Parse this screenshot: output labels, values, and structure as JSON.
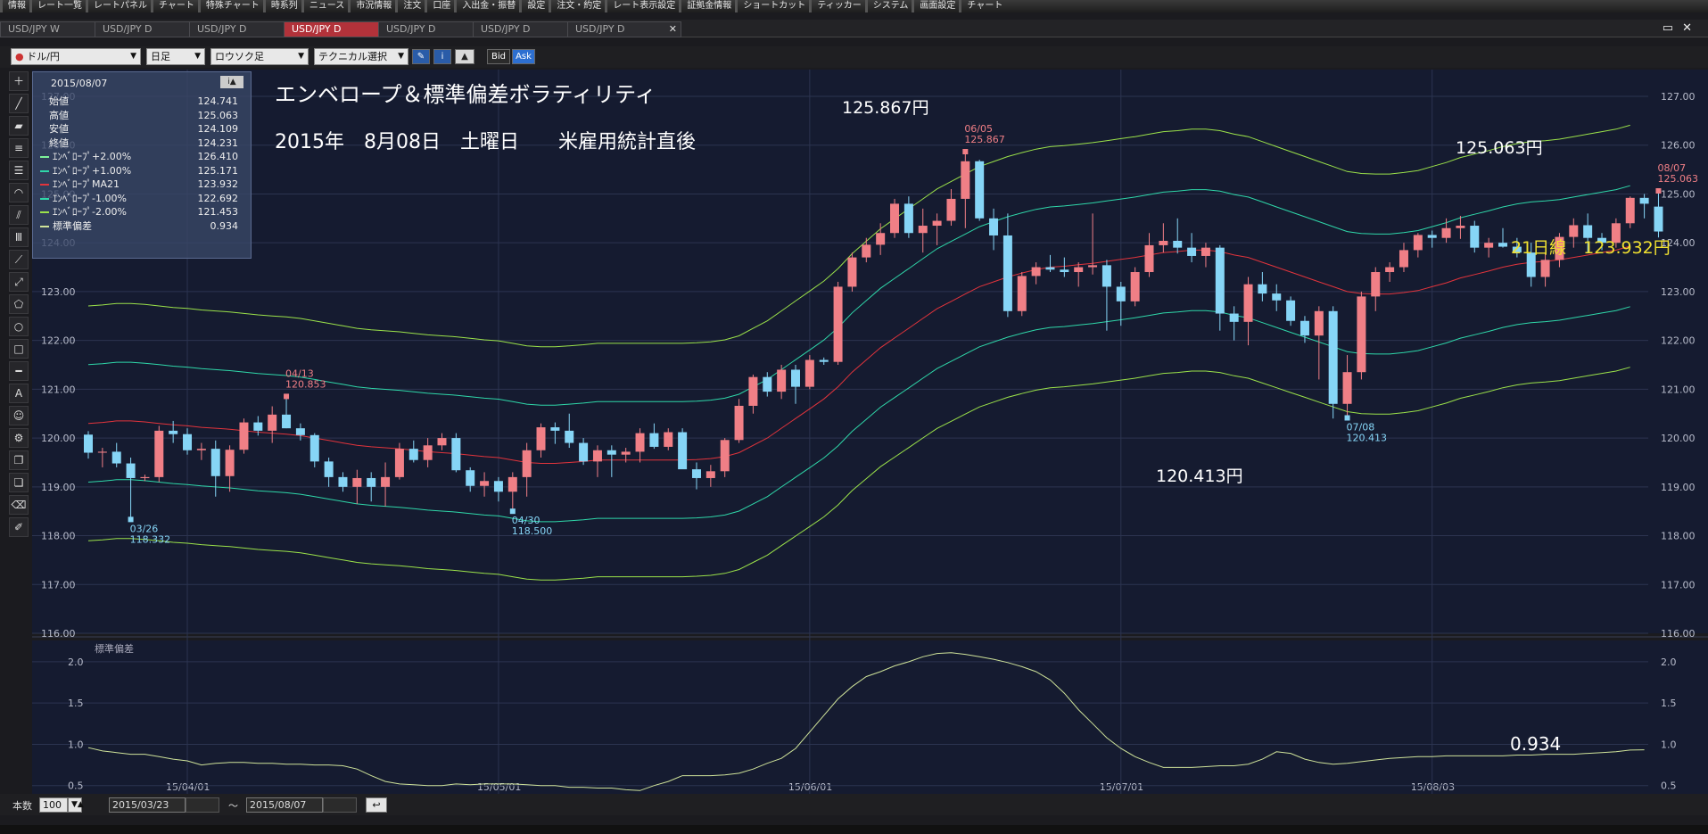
{
  "menu": [
    "情報",
    "レート一覧",
    "レートパネル",
    "チャート",
    "特殊チャート",
    "時系列",
    "ニュース",
    "市況情報",
    "注文",
    "口座",
    "入出金・振替",
    "設定",
    "注文・約定",
    "レート表示設定",
    "証拠金情報",
    "ショートカット",
    "ティッカー",
    "システム",
    "画面設定",
    "チャート"
  ],
  "tabs": [
    {
      "label": "USD/JPY W",
      "active": false
    },
    {
      "label": "USD/JPY D",
      "active": false
    },
    {
      "label": "USD/JPY D",
      "active": false
    },
    {
      "label": "USD/JPY D",
      "active": true
    },
    {
      "label": "USD/JPY D",
      "active": false
    },
    {
      "label": "USD/JPY D",
      "active": false
    },
    {
      "label": "USD/JPY D",
      "active": false
    }
  ],
  "toolbar": {
    "pair": "ドル/円",
    "period": "日足",
    "style": "ロウソク足",
    "tech": "テクニカル選択",
    "bid": "Bid",
    "ask": "Ask"
  },
  "info": {
    "date": "2015/08/07",
    "rows": [
      {
        "label": "始値",
        "value": "124.741",
        "color": ""
      },
      {
        "label": "高値",
        "value": "125.063",
        "color": ""
      },
      {
        "label": "安値",
        "value": "124.109",
        "color": ""
      },
      {
        "label": "終値",
        "value": "124.231",
        "color": ""
      },
      {
        "label": "ｴﾝﾍﾞﾛｰﾌﾟ+2.00%",
        "value": "126.410",
        "color": "#7ef29a"
      },
      {
        "label": "ｴﾝﾍﾞﾛｰﾌﾟ+1.00%",
        "value": "125.171",
        "color": "#2fd7a9"
      },
      {
        "label": "ｴﾝﾍﾞﾛｰﾌﾟMA21",
        "value": "123.932",
        "color": "#e2343c"
      },
      {
        "label": "ｴﾝﾍﾞﾛｰﾌﾟ-1.00%",
        "value": "122.692",
        "color": "#2fd7a9"
      },
      {
        "label": "ｴﾝﾍﾞﾛｰﾌﾟ-2.00%",
        "value": "121.453",
        "color": "#9be24a"
      },
      {
        "label": "標準偏差",
        "value": "0.934",
        "color": "#cfe39a"
      }
    ]
  },
  "annotations": {
    "title": "エンベロープ＆標準偏差ボラティリティ",
    "subtitle": "2015年　8月08日　土曜日　　米雇用統計直後",
    "high1": "125.867円",
    "high2": "125.063円",
    "low1": "120.413円",
    "ma21": "21日線　123.932円",
    "sd": "0.934"
  },
  "chart_labels": {
    "hi0605_date": "06/05",
    "hi0605_val": "125.867",
    "hi0807_date": "08/07",
    "hi0807_val": "125.063",
    "hi0413_date": "04/13",
    "hi0413_val": "120.853",
    "lo0326_date": "03/26",
    "lo0326_val": "118.332",
    "lo0430_date": "04/30",
    "lo0430_val": "118.500",
    "lo0708_date": "07/08",
    "lo0708_val": "120.413",
    "sub_title": "標準偏差"
  },
  "colors": {
    "bg": "#151b30",
    "up": "#f07f86",
    "down": "#86d5f6",
    "ma": "#e2343c",
    "env1": "#2fd7a9",
    "env2": "#9be24a",
    "sd": "#cfe39a",
    "price_label": "#ffffff",
    "yellow": "#f0e030"
  },
  "bottom": {
    "count_label": "本数",
    "count": "100",
    "from": "2015/03/23",
    "tilde": "～",
    "to": "2015/08/07"
  },
  "chart_data": {
    "type": "candlestick",
    "ylim": [
      116.0,
      127.0
    ],
    "yticks": [
      "127.00",
      "126.00",
      "125.00",
      "124.00",
      "123.00",
      "122.00",
      "121.00",
      "120.00",
      "119.00",
      "118.00",
      "117.00",
      "116.00"
    ],
    "xticks": [
      "15/04/01",
      "15/05/01",
      "15/06/01",
      "15/07/01",
      "15/08/03"
    ],
    "sub_ylim": [
      0.4,
      2.15
    ],
    "sub_yticks": [
      "2.0",
      "1.5",
      "1.0",
      "0.5"
    ],
    "candles": [
      [
        120.07,
        120.14,
        119.58,
        119.7
      ],
      [
        119.7,
        119.8,
        119.4,
        119.72
      ],
      [
        119.72,
        119.9,
        119.4,
        119.48
      ],
      [
        119.48,
        119.6,
        118.332,
        119.18
      ],
      [
        119.18,
        119.25,
        119.12,
        119.2
      ],
      [
        119.2,
        120.25,
        119.1,
        120.15
      ],
      [
        120.15,
        120.35,
        119.9,
        120.08
      ],
      [
        120.08,
        120.2,
        119.66,
        119.75
      ],
      [
        119.75,
        119.9,
        119.55,
        119.78
      ],
      [
        119.78,
        119.95,
        118.8,
        119.22
      ],
      [
        119.22,
        119.85,
        118.9,
        119.76
      ],
      [
        119.76,
        120.4,
        119.68,
        120.32
      ],
      [
        120.32,
        120.45,
        120.05,
        120.15
      ],
      [
        120.15,
        120.65,
        119.9,
        120.48
      ],
      [
        120.48,
        120.853,
        120.2,
        120.2
      ],
      [
        120.2,
        120.3,
        119.95,
        120.06
      ],
      [
        120.06,
        120.1,
        119.4,
        119.52
      ],
      [
        119.52,
        119.6,
        119.0,
        119.2
      ],
      [
        119.2,
        119.3,
        118.9,
        119.0
      ],
      [
        119.0,
        119.35,
        118.65,
        119.18
      ],
      [
        119.18,
        119.3,
        118.7,
        119.0
      ],
      [
        119.0,
        119.5,
        118.6,
        119.2
      ],
      [
        119.2,
        119.9,
        119.15,
        119.78
      ],
      [
        119.78,
        119.95,
        119.5,
        119.55
      ],
      [
        119.55,
        120.0,
        119.4,
        119.85
      ],
      [
        119.85,
        120.1,
        119.75,
        120.0
      ],
      [
        120.0,
        120.1,
        119.3,
        119.34
      ],
      [
        119.34,
        119.4,
        118.9,
        119.02
      ],
      [
        119.02,
        119.3,
        118.8,
        119.12
      ],
      [
        119.12,
        119.2,
        118.7,
        118.9
      ],
      [
        118.9,
        119.3,
        118.5,
        119.2
      ],
      [
        119.2,
        119.9,
        118.8,
        119.75
      ],
      [
        119.75,
        120.3,
        119.6,
        120.22
      ],
      [
        120.22,
        120.32,
        119.88,
        120.15
      ],
      [
        120.15,
        120.5,
        119.8,
        119.9
      ],
      [
        119.9,
        120.0,
        119.45,
        119.52
      ],
      [
        119.52,
        119.85,
        119.2,
        119.75
      ],
      [
        119.75,
        119.85,
        119.2,
        119.66
      ],
      [
        119.66,
        119.8,
        119.5,
        119.72
      ],
      [
        119.72,
        120.2,
        119.5,
        120.1
      ],
      [
        120.1,
        120.3,
        119.78,
        119.82
      ],
      [
        119.82,
        120.2,
        119.75,
        120.12
      ],
      [
        120.12,
        120.2,
        119.38,
        119.36
      ],
      [
        119.36,
        119.5,
        118.95,
        119.18
      ],
      [
        119.18,
        119.45,
        119.0,
        119.32
      ],
      [
        119.32,
        120.0,
        119.2,
        119.96
      ],
      [
        119.96,
        120.8,
        119.9,
        120.66
      ],
      [
        120.66,
        121.3,
        120.5,
        121.25
      ],
      [
        121.25,
        121.35,
        120.85,
        120.95
      ],
      [
        120.95,
        121.5,
        120.8,
        121.4
      ],
      [
        121.4,
        121.5,
        120.7,
        121.05
      ],
      [
        121.05,
        121.7,
        121.0,
        121.6
      ],
      [
        121.6,
        121.65,
        121.5,
        121.56
      ],
      [
        121.56,
        123.2,
        121.5,
        123.1
      ],
      [
        123.1,
        123.8,
        123.0,
        123.7
      ],
      [
        123.7,
        124.1,
        123.6,
        123.96
      ],
      [
        123.96,
        124.4,
        123.75,
        124.2
      ],
      [
        124.2,
        124.9,
        124.1,
        124.8
      ],
      [
        124.8,
        124.95,
        124.1,
        124.2
      ],
      [
        124.2,
        124.7,
        123.8,
        124.35
      ],
      [
        124.35,
        124.6,
        123.95,
        124.45
      ],
      [
        124.45,
        125.1,
        124.35,
        124.9
      ],
      [
        124.9,
        125.867,
        124.3,
        125.67
      ],
      [
        125.67,
        125.7,
        124.45,
        124.5
      ],
      [
        124.5,
        124.7,
        123.85,
        124.15
      ],
      [
        124.15,
        124.6,
        122.48,
        122.6
      ],
      [
        122.6,
        123.4,
        122.5,
        123.32
      ],
      [
        123.32,
        123.6,
        123.15,
        123.5
      ],
      [
        123.5,
        123.75,
        123.4,
        123.45
      ],
      [
        123.45,
        123.7,
        123.3,
        123.4
      ],
      [
        123.4,
        123.6,
        123.1,
        123.5
      ],
      [
        123.5,
        124.6,
        123.35,
        123.54
      ],
      [
        123.54,
        123.65,
        122.2,
        123.1
      ],
      [
        123.1,
        123.2,
        122.3,
        122.8
      ],
      [
        122.8,
        123.5,
        122.7,
        123.4
      ],
      [
        123.4,
        124.2,
        123.3,
        123.95
      ],
      [
        123.95,
        124.4,
        123.8,
        124.04
      ],
      [
        124.04,
        124.5,
        123.78,
        123.9
      ],
      [
        123.9,
        124.2,
        123.6,
        123.73
      ],
      [
        123.73,
        124.0,
        123.5,
        123.9
      ],
      [
        123.9,
        123.95,
        122.2,
        122.55
      ],
      [
        122.55,
        122.7,
        122.0,
        122.38
      ],
      [
        122.38,
        123.3,
        121.9,
        123.15
      ],
      [
        123.15,
        123.4,
        122.8,
        122.96
      ],
      [
        122.96,
        123.15,
        122.6,
        122.82
      ],
      [
        122.82,
        122.9,
        122.3,
        122.4
      ],
      [
        122.4,
        122.5,
        121.95,
        122.1
      ],
      [
        122.1,
        122.7,
        121.2,
        122.6
      ],
      [
        122.6,
        122.7,
        120.4,
        120.7
      ],
      [
        120.7,
        121.7,
        120.413,
        121.35
      ],
      [
        121.35,
        123.0,
        121.2,
        122.9
      ],
      [
        122.9,
        123.5,
        122.6,
        123.4
      ],
      [
        123.4,
        123.6,
        123.2,
        123.5
      ],
      [
        123.5,
        124.0,
        123.4,
        123.85
      ],
      [
        123.85,
        124.2,
        123.7,
        124.16
      ],
      [
        124.16,
        124.25,
        123.9,
        124.1
      ],
      [
        124.1,
        124.5,
        124.0,
        124.3
      ],
      [
        124.3,
        124.55,
        124.08,
        124.35
      ],
      [
        124.35,
        124.45,
        123.8,
        123.9
      ],
      [
        123.9,
        124.1,
        123.7,
        124.0
      ],
      [
        124.0,
        124.3,
        123.9,
        123.92
      ],
      [
        123.92,
        124.1,
        123.7,
        123.8
      ],
      [
        123.8,
        124.0,
        123.1,
        123.3
      ],
      [
        123.3,
        123.8,
        123.1,
        123.65
      ],
      [
        123.65,
        124.2,
        123.5,
        124.12
      ],
      [
        124.12,
        124.5,
        123.9,
        124.36
      ],
      [
        124.36,
        124.6,
        123.8,
        124.1
      ],
      [
        124.1,
        124.2,
        123.85,
        124.0
      ],
      [
        124.0,
        124.5,
        123.9,
        124.4
      ],
      [
        124.4,
        124.95,
        124.3,
        124.92
      ],
      [
        124.92,
        125.0,
        124.5,
        124.8
      ],
      [
        124.741,
        125.063,
        124.109,
        124.231
      ]
    ],
    "ma21": [
      120.3,
      120.32,
      120.35,
      120.35,
      120.33,
      120.3,
      120.27,
      120.25,
      120.22,
      120.2,
      120.18,
      120.15,
      120.12,
      120.1,
      120.08,
      120.05,
      120.0,
      119.95,
      119.9,
      119.85,
      119.82,
      119.8,
      119.78,
      119.75,
      119.72,
      119.7,
      119.68,
      119.65,
      119.62,
      119.6,
      119.55,
      119.5,
      119.48,
      119.48,
      119.5,
      119.52,
      119.55,
      119.55,
      119.55,
      119.55,
      119.55,
      119.55,
      119.55,
      119.56,
      119.58,
      119.62,
      119.7,
      119.85,
      120.0,
      120.2,
      120.4,
      120.6,
      120.8,
      121.05,
      121.35,
      121.6,
      121.85,
      122.05,
      122.25,
      122.45,
      122.65,
      122.8,
      122.95,
      123.1,
      123.2,
      123.3,
      123.38,
      123.45,
      123.5,
      123.52,
      123.55,
      123.58,
      123.62,
      123.66,
      123.7,
      123.75,
      123.8,
      123.82,
      123.85,
      123.85,
      123.82,
      123.75,
      123.7,
      123.6,
      123.5,
      123.4,
      123.3,
      123.2,
      123.1,
      123.0,
      122.96,
      122.95,
      122.95,
      122.98,
      123.02,
      123.1,
      123.18,
      123.28,
      123.35,
      123.42,
      123.5,
      123.56,
      123.6,
      123.62,
      123.65,
      123.7,
      123.75,
      123.8,
      123.85,
      123.93
    ],
    "stddev": [
      0.96,
      0.92,
      0.9,
      0.88,
      0.88,
      0.85,
      0.82,
      0.8,
      0.75,
      0.77,
      0.78,
      0.78,
      0.77,
      0.77,
      0.76,
      0.76,
      0.75,
      0.75,
      0.74,
      0.7,
      0.62,
      0.55,
      0.52,
      0.51,
      0.5,
      0.5,
      0.52,
      0.51,
      0.52,
      0.52,
      0.52,
      0.51,
      0.5,
      0.5,
      0.48,
      0.48,
      0.47,
      0.47,
      0.45,
      0.44,
      0.5,
      0.55,
      0.62,
      0.62,
      0.62,
      0.63,
      0.65,
      0.7,
      0.77,
      0.83,
      0.95,
      1.15,
      1.35,
      1.55,
      1.7,
      1.82,
      1.88,
      1.95,
      2.0,
      2.06,
      2.1,
      2.11,
      2.09,
      2.06,
      2.03,
      1.99,
      1.94,
      1.88,
      1.78,
      1.62,
      1.42,
      1.25,
      1.08,
      0.95,
      0.85,
      0.78,
      0.72,
      0.72,
      0.72,
      0.73,
      0.74,
      0.74,
      0.76,
      0.82,
      0.91,
      0.89,
      0.82,
      0.78,
      0.76,
      0.77,
      0.79,
      0.81,
      0.83,
      0.84,
      0.85,
      0.85,
      0.86,
      0.86,
      0.86,
      0.86,
      0.86,
      0.87,
      0.87,
      0.88,
      0.88,
      0.88,
      0.89,
      0.9,
      0.91,
      0.93,
      0.934
    ]
  }
}
